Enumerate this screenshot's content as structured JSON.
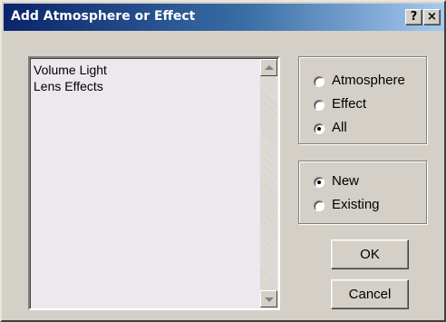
{
  "window": {
    "title": "Add  Atmosphere or Effect",
    "help_label": "?",
    "close_label": "×"
  },
  "list": {
    "items": [
      "Volume Light",
      "Lens Effects"
    ]
  },
  "type_group": {
    "options": [
      {
        "label": "Atmosphere",
        "selected": false
      },
      {
        "label": "Effect",
        "selected": false
      },
      {
        "label": "All",
        "selected": true
      }
    ]
  },
  "mode_group": {
    "options": [
      {
        "label": "New",
        "selected": true
      },
      {
        "label": "Existing",
        "selected": false
      }
    ]
  },
  "buttons": {
    "ok_label": "OK",
    "cancel_label": "Cancel"
  },
  "colors": {
    "title_gradient_start": "#0a246a",
    "title_gradient_end": "#a6caf0",
    "dialog_face": "#d4d0c8",
    "list_background": "#ece8ee"
  },
  "icons": {
    "scroll_up": "arrow-up-icon",
    "scroll_down": "arrow-down-icon"
  }
}
